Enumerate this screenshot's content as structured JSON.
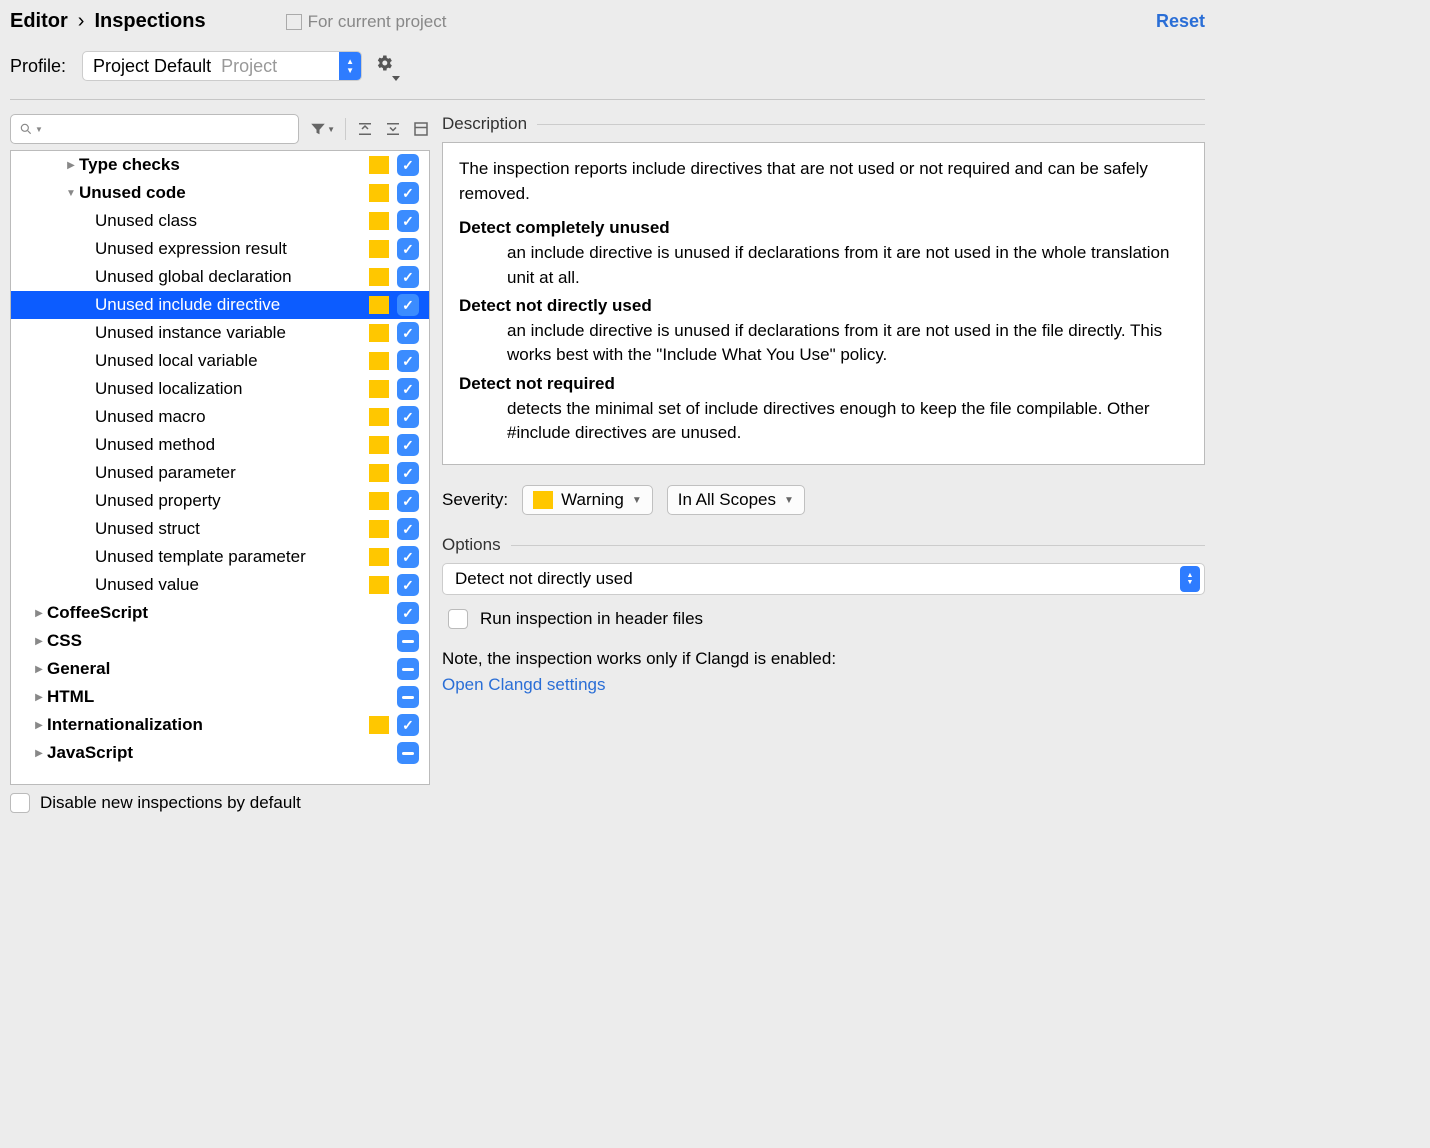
{
  "breadcrumb": {
    "parent": "Editor",
    "current": "Inspections"
  },
  "scope_text": "For current project",
  "reset": "Reset",
  "profile": {
    "label": "Profile:",
    "name": "Project Default",
    "scope": "Project"
  },
  "toolbar": {
    "search_placeholder": "",
    "filter_tip": "Filter",
    "expand_tip": "Expand All",
    "collapse_tip": "Collapse All",
    "show_tip": "Show"
  },
  "tree": {
    "type_checks": "Type checks",
    "unused_code": "Unused code",
    "items": [
      "Unused class",
      "Unused expression result",
      "Unused global declaration",
      "Unused include directive",
      "Unused instance variable",
      "Unused local variable",
      "Unused localization",
      "Unused macro",
      "Unused method",
      "Unused parameter",
      "Unused property",
      "Unused struct",
      "Unused template parameter",
      "Unused value"
    ],
    "coffeescript": "CoffeeScript",
    "css": "CSS",
    "general": "General",
    "html": "HTML",
    "i18n": "Internationalization",
    "javascript": "JavaScript"
  },
  "disable_label": "Disable new inspections by default",
  "description": {
    "title": "Description",
    "intro": "The inspection reports include directives that are not used or not required and can be safely removed.",
    "t1": "Detect completely unused",
    "d1": "an include directive is unused if declarations from it are not used in the whole translation unit at all.",
    "t2": "Detect not directly used",
    "d2": "an include directive is unused if declarations from it are not used in the file directly. This works best with the \"Include What You Use\" policy.",
    "t3": "Detect not required",
    "d3": "detects the minimal set of include directives enough to keep the file compilable. Other #include directives are unused."
  },
  "severity": {
    "label": "Severity:",
    "value": "Warning",
    "scope": "In All Scopes"
  },
  "options": {
    "title": "Options",
    "selected": "Detect not directly used",
    "checkbox": "Run inspection in header files",
    "note": "Note, the inspection works only if Clangd is enabled:",
    "link": "Open Clangd settings"
  }
}
